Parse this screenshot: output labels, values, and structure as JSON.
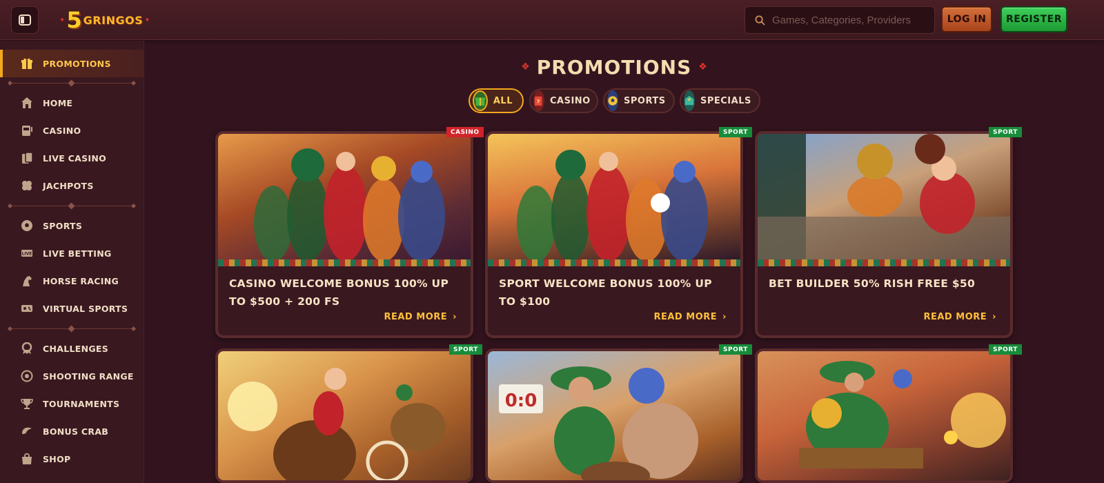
{
  "header": {
    "logo_number": "5",
    "logo_text": "GRINGOS",
    "search_placeholder": "Games, Categories, Providers",
    "login_label": "LOG IN",
    "register_label": "REGISTER"
  },
  "sidebar": {
    "items": [
      {
        "label": "PROMOTIONS",
        "icon": "gift-icon",
        "active": true
      },
      {
        "label": "HOME",
        "icon": "home-icon"
      },
      {
        "label": "CASINO",
        "icon": "slot-machine-icon"
      },
      {
        "label": "LIVE CASINO",
        "icon": "cards-icon"
      },
      {
        "label": "JACHPOTS",
        "icon": "clover-icon"
      },
      {
        "label": "SPORTS",
        "icon": "ball-icon"
      },
      {
        "label": "LIVE BETTING",
        "icon": "live-icon"
      },
      {
        "label": "HORSE RACING",
        "icon": "horse-icon"
      },
      {
        "label": "VIRTUAL SPORTS",
        "icon": "controller-icon"
      },
      {
        "label": "CHALLENGES",
        "icon": "medal-icon"
      },
      {
        "label": "SHOOTING RANGE",
        "icon": "target-icon"
      },
      {
        "label": "TOURNAMENTS",
        "icon": "trophy-icon"
      },
      {
        "label": "BONUS CRAB",
        "icon": "crab-icon"
      },
      {
        "label": "SHOP",
        "icon": "bag-icon"
      }
    ]
  },
  "main": {
    "title": "PROMOTIONS",
    "filters": [
      {
        "label": "ALL",
        "icon": "gift-icon",
        "active": true
      },
      {
        "label": "CASINO",
        "icon": "slot-icon"
      },
      {
        "label": "SPORTS",
        "icon": "ball-icon"
      },
      {
        "label": "SPECIALS",
        "icon": "tag-icon"
      }
    ],
    "cards": [
      {
        "tag": "CASINO",
        "title": "CASINO WELCOME BONUS 100% UP TO $500 + 200 FS",
        "read_more": "READ MORE"
      },
      {
        "tag": "SPORT",
        "title": "SPORT WELCOME BONUS 100% UP TO $100",
        "read_more": "READ MORE"
      },
      {
        "tag": "SPORT",
        "title": "BET BUILDER 50% RISH FREE $50",
        "read_more": "READ MORE"
      },
      {
        "tag": "SPORT",
        "title": "",
        "read_more": ""
      },
      {
        "tag": "SPORT",
        "title": "",
        "read_more": "",
        "scoreboard": "0:0"
      },
      {
        "tag": "SPORT",
        "title": "",
        "read_more": ""
      }
    ]
  },
  "colors": {
    "background": "#33141e",
    "accent_gold": "#ffc13a",
    "casino_red": "#d2242a",
    "sport_green": "#178c3b",
    "register_green": "#2fb547",
    "login_orange": "#c45a2a"
  }
}
